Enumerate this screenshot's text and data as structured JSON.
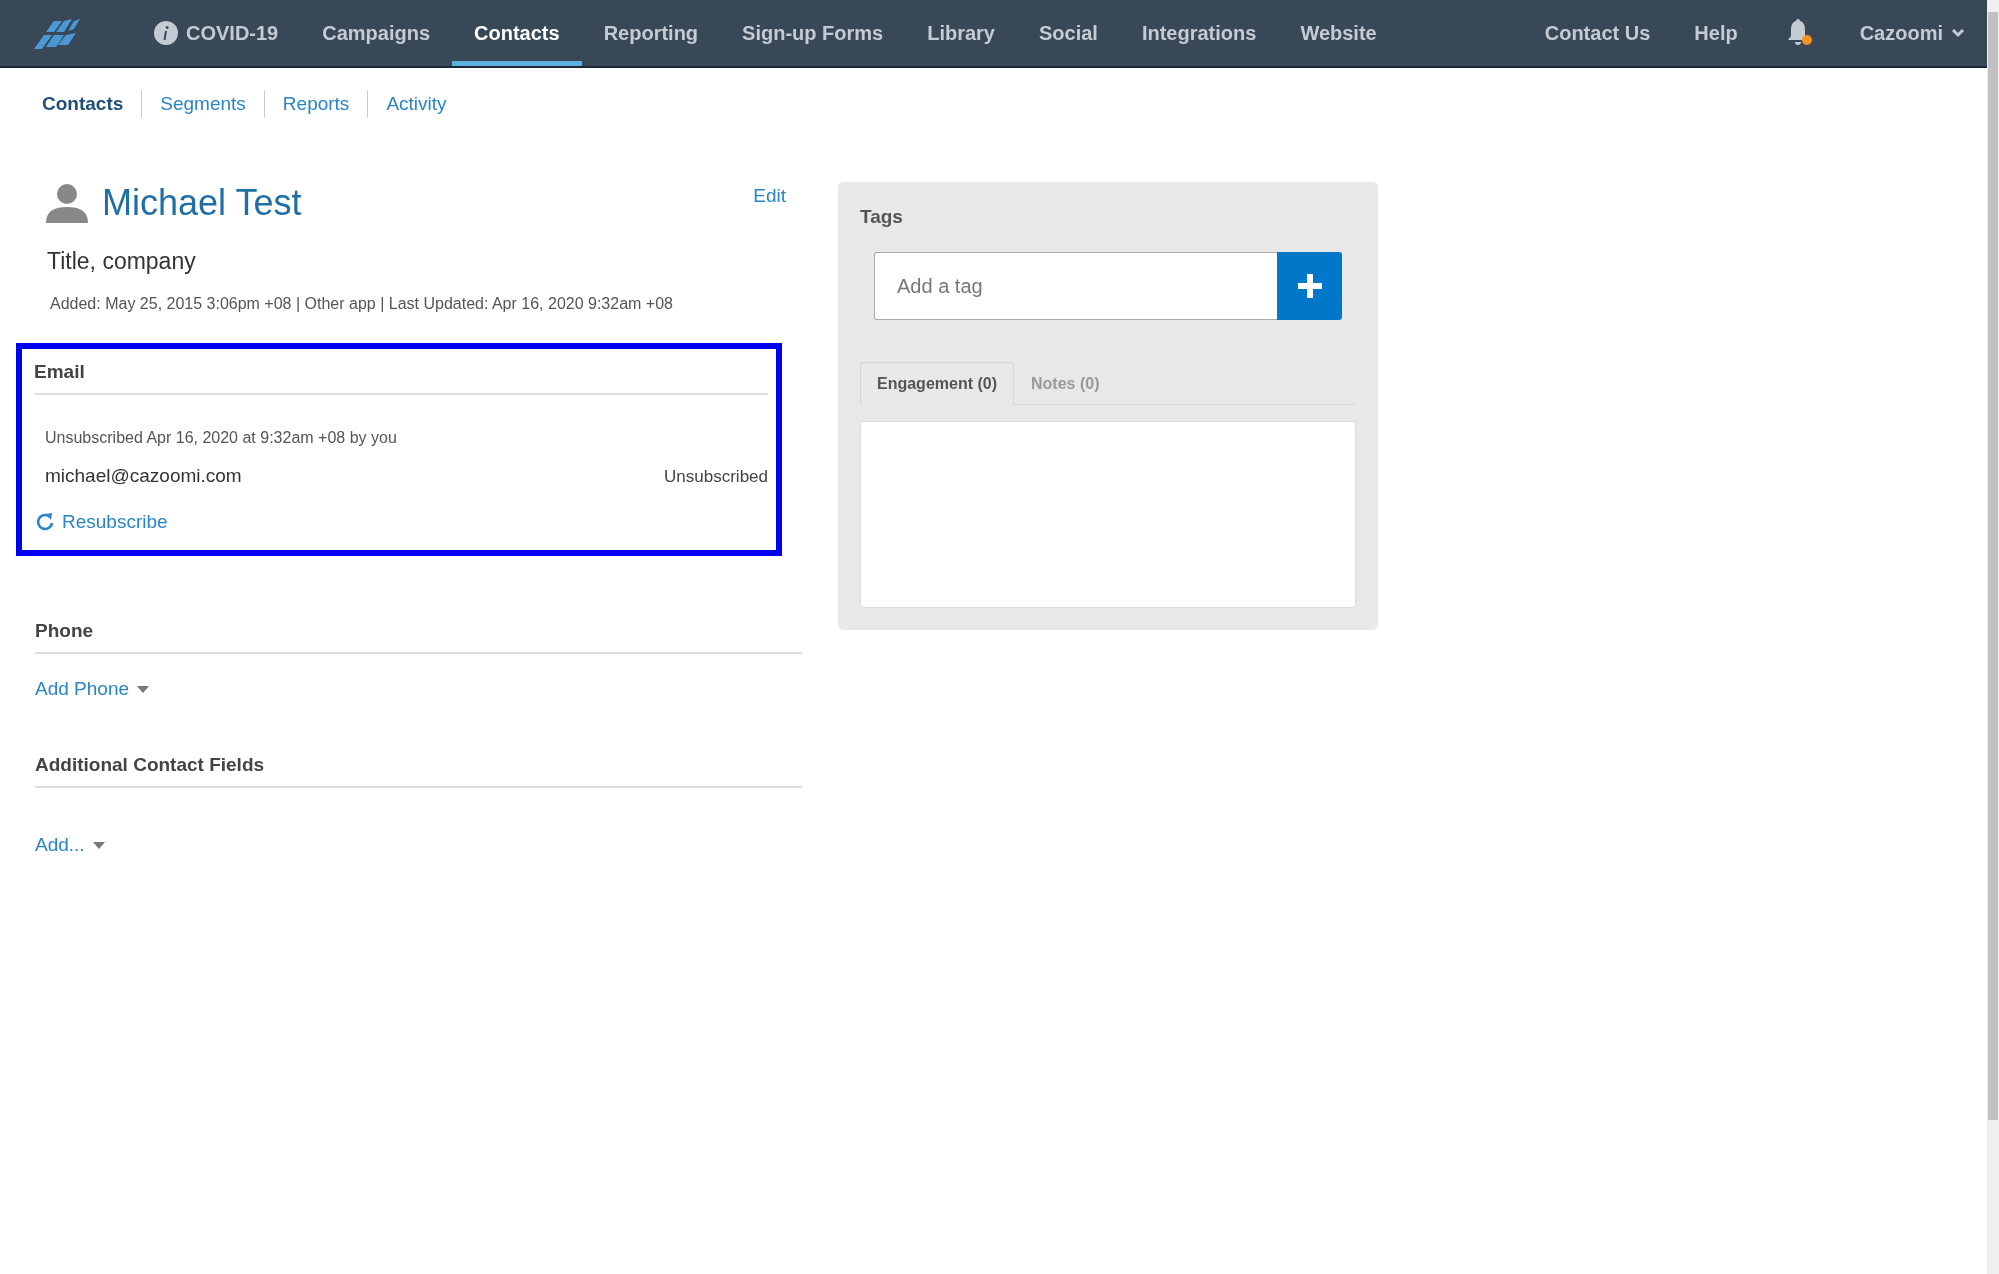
{
  "nav": {
    "items": [
      {
        "label": "COVID-19",
        "kind": "info",
        "selected": false
      },
      {
        "label": "Campaigns",
        "kind": "plain",
        "selected": false
      },
      {
        "label": "Contacts",
        "kind": "plain",
        "selected": true
      },
      {
        "label": "Reporting",
        "kind": "plain",
        "selected": false
      },
      {
        "label": "Sign-up Forms",
        "kind": "plain",
        "selected": false
      },
      {
        "label": "Library",
        "kind": "plain",
        "selected": false
      },
      {
        "label": "Social",
        "kind": "plain",
        "selected": false
      },
      {
        "label": "Integrations",
        "kind": "plain",
        "selected": false
      },
      {
        "label": "Website",
        "kind": "plain",
        "selected": false
      }
    ],
    "right_items": [
      {
        "label": "Contact Us"
      },
      {
        "label": "Help"
      }
    ],
    "notifications": {
      "unread": true
    },
    "account": {
      "label": "Cazoomi"
    }
  },
  "subnav": [
    {
      "label": "Contacts",
      "selected": true
    },
    {
      "label": "Segments",
      "selected": false
    },
    {
      "label": "Reports",
      "selected": false
    },
    {
      "label": "Activity",
      "selected": false
    }
  ],
  "contact": {
    "name": "Michael Test",
    "edit": "Edit",
    "subtitle": "Title, company",
    "meta": "Added: May 25, 2015 3:06pm +08 | Other app | Last Updated: Apr 16, 2020 9:32am +08"
  },
  "email": {
    "heading": "Email",
    "highlighted": true,
    "note": "Unsubscribed Apr 16, 2020 at 9:32am +08 by you",
    "address": "michael@cazoomi.com",
    "status": "Unsubscribed",
    "action": "Resubscribe"
  },
  "phone": {
    "heading": "Phone",
    "action": "Add Phone"
  },
  "additional": {
    "heading": "Additional Contact Fields",
    "action": "Add..."
  },
  "tags": {
    "heading": "Tags",
    "placeholder": "Add a tag",
    "tabs": [
      {
        "label": "Engagement (0)",
        "selected": true
      },
      {
        "label": "Notes (0)",
        "selected": false
      }
    ]
  }
}
